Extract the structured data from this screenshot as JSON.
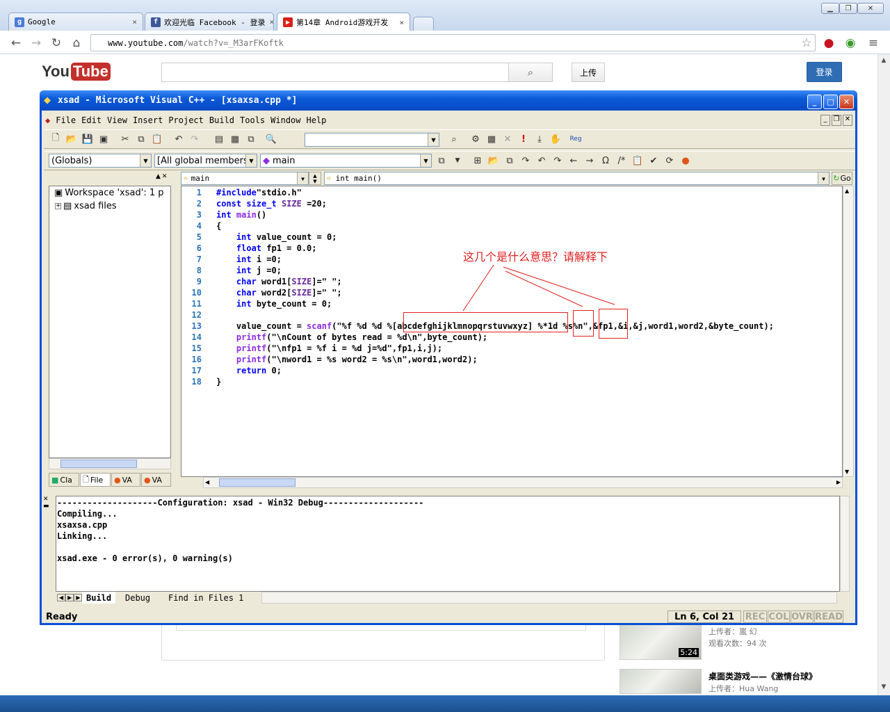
{
  "browser": {
    "tabs": [
      {
        "label": "Google",
        "favicon": "google-icon"
      },
      {
        "label": "欢迎光临 Facebook - 登录",
        "favicon": "facebook-icon"
      },
      {
        "label": "第14章 Android游戏开发",
        "favicon": "youtube-icon",
        "active": true
      }
    ],
    "url_host": "www.youtube.com",
    "url_path": "/watch?v=_M3arFKoftk"
  },
  "youtube": {
    "logo_you": "You",
    "logo_tube": "Tube",
    "upload_label": "上传",
    "login_label": "登录",
    "sidebar_videos": [
      {
        "title": "",
        "uploader": "上传者：嵐 幻",
        "views": "观看次数：94 次",
        "duration": "5:24"
      },
      {
        "title": "桌面类游戏——《激情台球》",
        "uploader": "上传者：Hua Wang",
        "views": "",
        "duration": ""
      }
    ]
  },
  "vc": {
    "title": "xsad - Microsoft Visual C++ - [xsaxsa.cpp *]",
    "menu": [
      "File",
      "Edit",
      "View",
      "Insert",
      "Project",
      "Build",
      "Tools",
      "Window",
      "Help"
    ],
    "combo_globals": "(Globals)",
    "combo_members": "[All global members",
    "combo_main": "main",
    "nav_scope": "main",
    "nav_function": "int main()",
    "go_label": "Go",
    "reg_label": "Reg",
    "workspace_root": "Workspace 'xsad': 1 p",
    "workspace_files": "xsad files",
    "workspace_tabs": [
      "Cla",
      "File",
      "VA",
      "VA"
    ],
    "code_lines": [
      "#include\"stdio.h\"",
      "const size_t SIZE =20;",
      "int main()",
      "{",
      "    int value_count = 0;",
      "    float fp1 = 0.0;",
      "    int i =0;",
      "    int j =0;",
      "    char word1[SIZE]=\" \";",
      "    char word2[SIZE]=\" \";",
      "    int byte_count = 0;",
      "",
      "    value_count = scanf(\"%f %d %d %[abcdefghijklmnopqrstuvwxyz] %*1d %s%n\",&fp1,&i,&j,word1,word2,&byte_count);",
      "    printf(\"\\nCount of bytes read = %d\\n\",byte_count);",
      "    printf(\"\\nfp1 = %f i = %d j=%d\",fp1,i,j);",
      "    printf(\"\\nword1 = %s word2 = %s\\n\",word1,word2);",
      "    return 0;",
      "}"
    ],
    "output_lines": [
      "--------------------Configuration: xsad - Win32 Debug--------------------",
      "Compiling...",
      "xsaxsa.cpp",
      "Linking...",
      "",
      "xsad.exe - 0 error(s), 0 warning(s)"
    ],
    "output_tabs": [
      "Build",
      "Debug",
      "Find in Files 1"
    ],
    "status_text": "Ready",
    "status_pos": "Ln 6, Col 21",
    "status_flags": [
      "REC",
      "COL",
      "OVR",
      "READ"
    ]
  },
  "annotation": {
    "question": "这几个是什么意思？请解释下",
    "color": "#e02020"
  }
}
